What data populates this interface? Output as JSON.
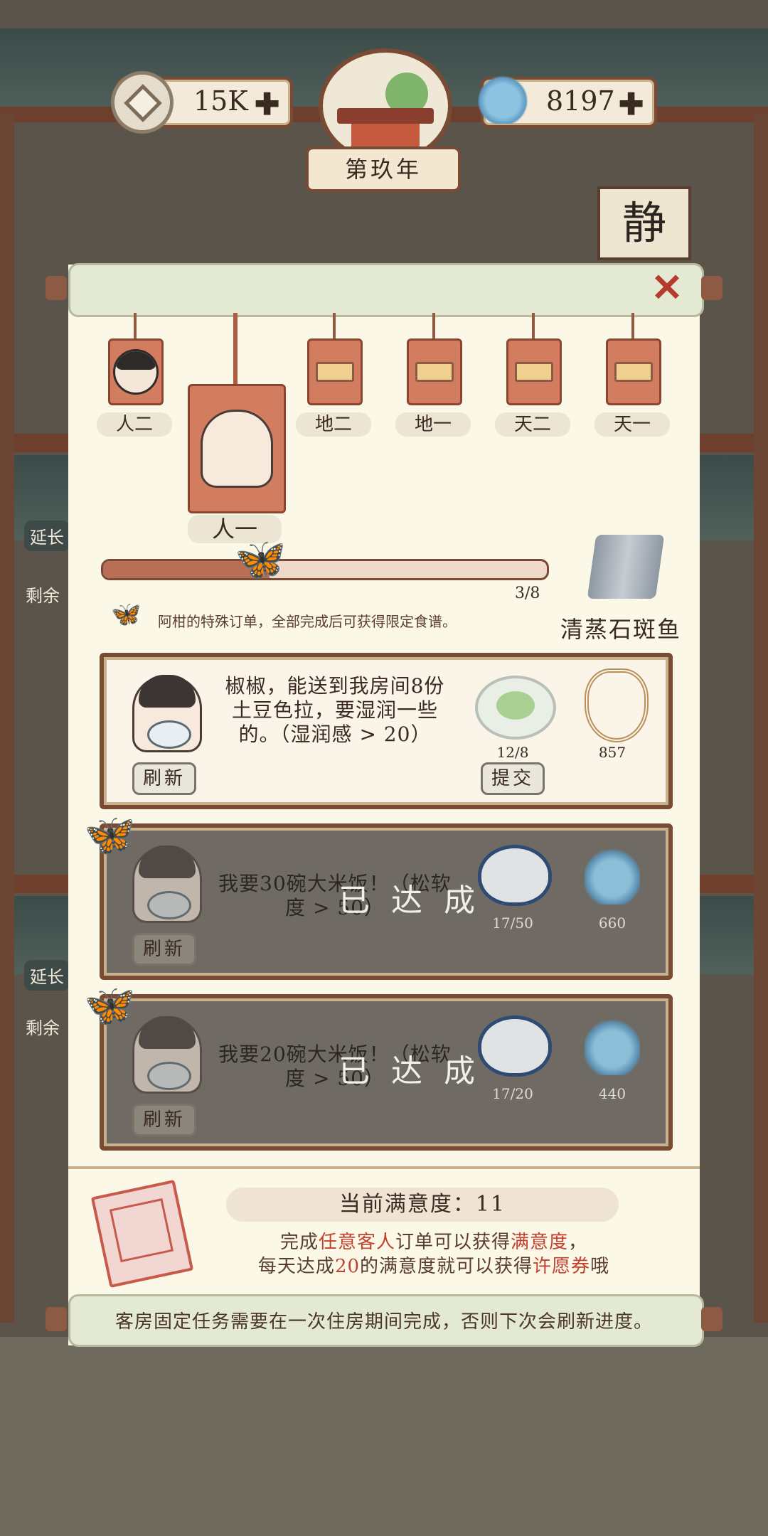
{
  "hud": {
    "coins": "15K",
    "spirit": "8197",
    "year": "第玖年"
  },
  "background": {
    "sign_char": "静",
    "side_labels": [
      "延长",
      "剩余",
      "延长",
      "剩余"
    ]
  },
  "panel": {
    "tags": [
      {
        "label": "人二",
        "type": "avatar"
      },
      {
        "label": "人一",
        "type": "avatar",
        "selected": true
      },
      {
        "label": "地二",
        "type": "locked"
      },
      {
        "label": "地一",
        "type": "locked"
      },
      {
        "label": "天二",
        "type": "locked"
      },
      {
        "label": "天一",
        "type": "locked"
      }
    ],
    "progress": {
      "text": "3/8",
      "fraction": 0.375
    },
    "note": "阿柑的特殊订单，全部完成后可获得限定食谱。",
    "reward_name": "清蒸石斑鱼",
    "orders": [
      {
        "text": "椒椒，能送到我房间8份土豆色拉，要湿润一些的。（湿润感 > 20）",
        "count": "12/8",
        "reward": "857",
        "refresh": "刷新",
        "submit": "提交",
        "done": false
      },
      {
        "text": "我要30碗大米饭！（松软度 > 50）",
        "count": "17/50",
        "reward": "660",
        "refresh": "刷新",
        "stamp": "已达成",
        "done": true
      },
      {
        "text": "我要20碗大米饭！（松软度 > 50）",
        "count": "17/20",
        "reward": "440",
        "refresh": "刷新",
        "stamp": "已达成",
        "done": true
      }
    ],
    "satisfaction": {
      "title": "当前满意度：11",
      "line1_a": "完成",
      "line1_b": "任意客人",
      "line1_c": "订单可以获得",
      "line1_d": "满意度",
      "line1_e": "，",
      "line2_a": "每天达成",
      "line2_b": "20",
      "line2_c": "的满意度就可以获得",
      "line2_d": "许愿券",
      "line2_e": "哦"
    },
    "bottom_note": "客房固定任务需要在一次住房期间完成，否则下次会刷新进度。"
  }
}
